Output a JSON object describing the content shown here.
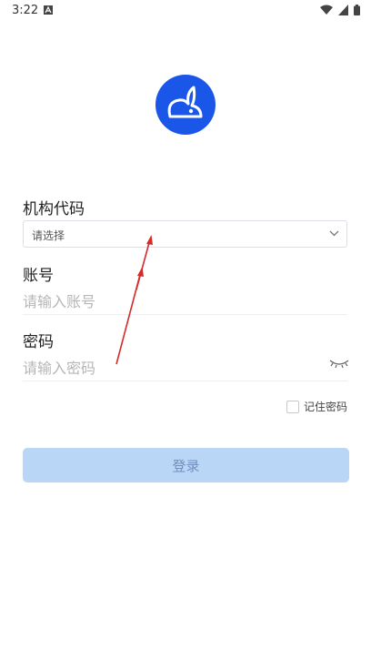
{
  "status_bar": {
    "time": "3:22"
  },
  "form": {
    "org_label": "机构代码",
    "org_select_value": "请选择",
    "account_label": "账号",
    "account_placeholder": "请输入账号",
    "password_label": "密码",
    "password_placeholder": "请输入密码",
    "remember_label": "记住密码",
    "remember_checked": false,
    "login_button": "登录"
  },
  "colors": {
    "brand": "#1a56e8",
    "button_bg": "#bad6f6",
    "button_text": "#6f8fbf",
    "annotation_arrow": "#d42a2a"
  },
  "icons": [
    "logo-rabbit-icon",
    "chevron-down-icon",
    "eye-closed-icon",
    "notification-icon",
    "wifi-icon",
    "signal-icon",
    "battery-icon"
  ]
}
